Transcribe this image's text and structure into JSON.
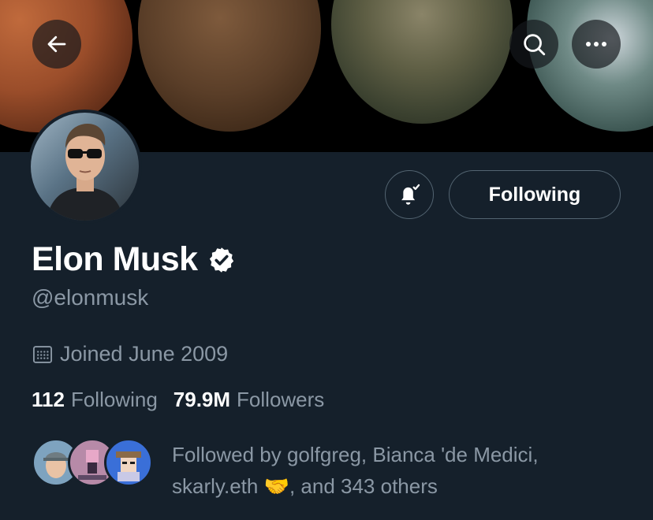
{
  "header": {
    "back_icon": "arrow-left-icon",
    "search_icon": "search-icon",
    "more_icon": "more-horizontal-icon"
  },
  "profile": {
    "name": "Elon Musk",
    "handle": "@elonmusk",
    "verified": true,
    "joined": "Joined June 2009",
    "following_count": "112",
    "following_label": "Following",
    "followers_count": "79.9M",
    "followers_label": "Followers"
  },
  "actions": {
    "notification_icon": "bell-check-icon",
    "following_button": "Following"
  },
  "followed_by": {
    "text_line1": "Followed by golfgreg, Bianca 'de Medici,",
    "text_line2_a": "skarly.eth",
    "emoji": "🤝",
    "text_line2_b": ", and 343 others"
  },
  "colors": {
    "background": "#15202b",
    "secondary_text": "#8b98a5",
    "border": "#536471"
  }
}
